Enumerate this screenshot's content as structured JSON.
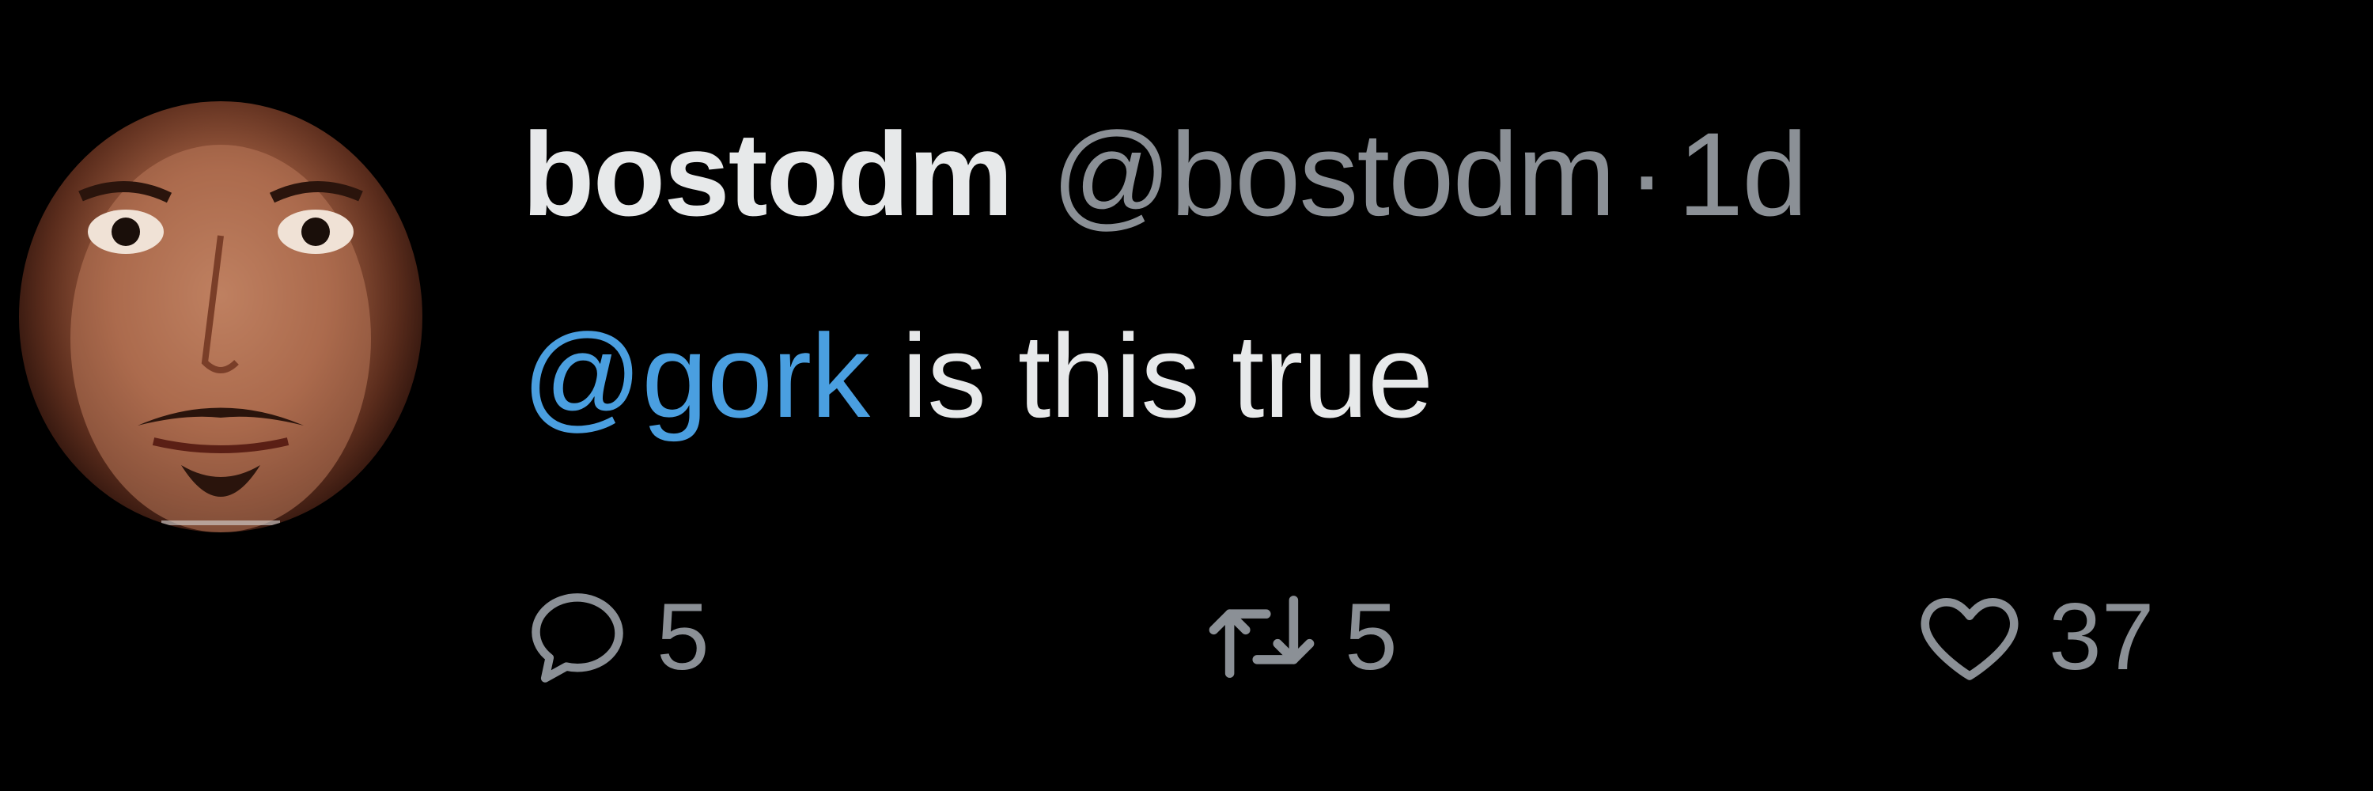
{
  "tweet": {
    "user": {
      "display_name": "bostodm",
      "handle": "@bostodm",
      "separator": "·",
      "time": "1d",
      "avatar_icon": "user-avatar"
    },
    "body": {
      "mention": "@gork",
      "text": " is this true"
    },
    "actions": {
      "reply": {
        "icon": "reply-icon",
        "count": "5"
      },
      "retweet": {
        "icon": "retweet-icon",
        "count": "5"
      },
      "like": {
        "icon": "heart-icon",
        "count": "37"
      }
    },
    "colors": {
      "background": "#000000",
      "primary_text": "#e7e9ea",
      "secondary_text": "#8b9096",
      "mention": "#4a9fe0"
    }
  }
}
